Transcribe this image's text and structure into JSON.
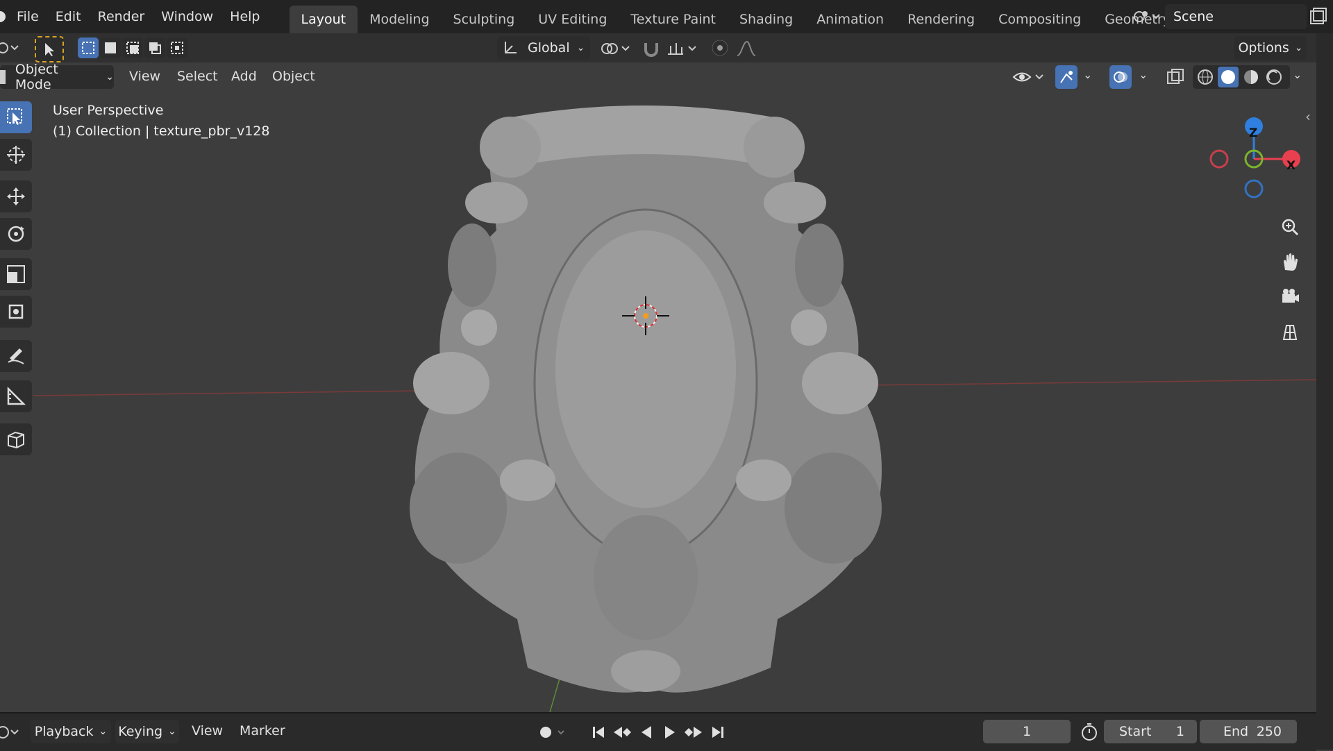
{
  "menu": [
    "File",
    "Edit",
    "Render",
    "Window",
    "Help"
  ],
  "workspace_tabs": [
    {
      "label": "Layout",
      "active": true
    },
    {
      "label": "Modeling",
      "active": false
    },
    {
      "label": "Sculpting",
      "active": false
    },
    {
      "label": "UV Editing",
      "active": false
    },
    {
      "label": "Texture Paint",
      "active": false
    },
    {
      "label": "Shading",
      "active": false
    },
    {
      "label": "Animation",
      "active": false
    },
    {
      "label": "Rendering",
      "active": false
    },
    {
      "label": "Compositing",
      "active": false
    },
    {
      "label": "Geometry Nod",
      "active": false
    }
  ],
  "scene": {
    "label": "Scene"
  },
  "tool_header": {
    "orientation": "Global",
    "options_label": "Options"
  },
  "viewport_header": {
    "mode": "Object Mode",
    "menus": [
      "View",
      "Select",
      "Add",
      "Object"
    ]
  },
  "viewport_info": {
    "view_name": "User Perspective",
    "collection_line": "(1) Collection | texture_pbr_v128"
  },
  "gizmo": {
    "z_label": "Z",
    "x_label": "X",
    "x_color": "#e8404f",
    "y_color": "#7bb32e",
    "z_color": "#2f7fe0"
  },
  "timeline": {
    "menus": [
      "Playback",
      "Keying",
      "View",
      "Marker"
    ],
    "current_frame": "1",
    "start_label": "Start",
    "start_value": "1",
    "end_label": "End",
    "end_value": "250"
  },
  "icons": [
    "select-box-icon",
    "cursor-icon",
    "move-icon",
    "rotate-icon",
    "scale-icon",
    "transform-icon",
    "annotate-icon",
    "measure-icon",
    "add-cube-icon",
    "zoom-icon",
    "hand-icon",
    "camera-icon",
    "grid-icon"
  ],
  "colors": {
    "accent": "#4772b3",
    "background": "#3d3d3d",
    "header": "#232323"
  }
}
